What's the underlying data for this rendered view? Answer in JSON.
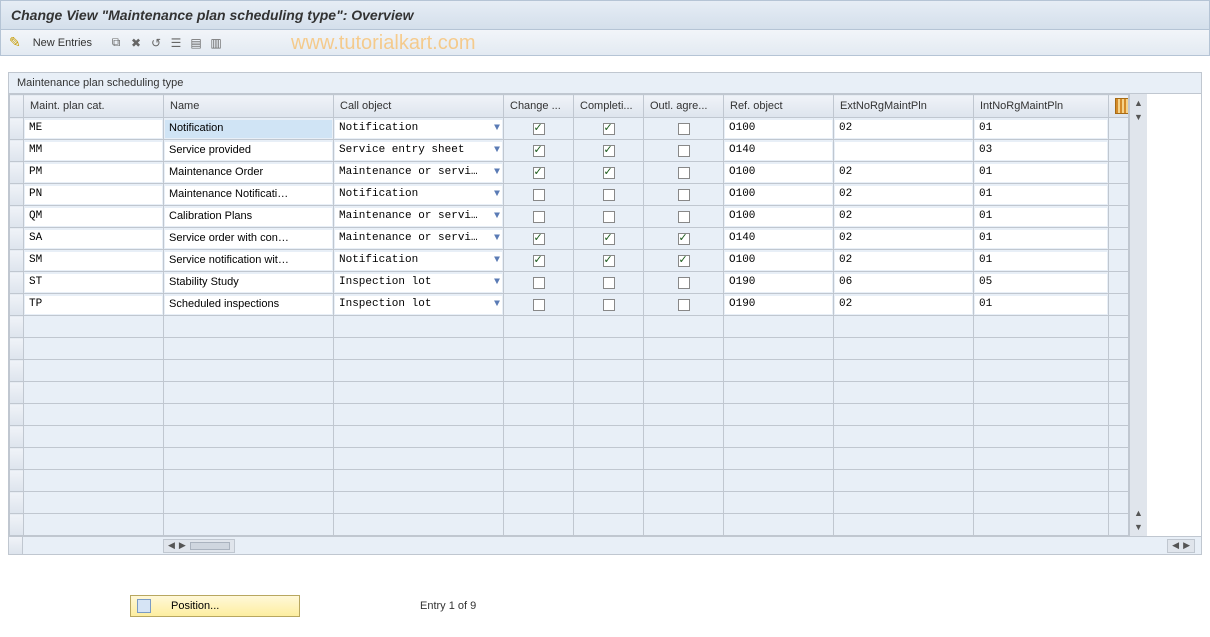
{
  "title": "Change View \"Maintenance plan scheduling type\": Overview",
  "toolbar": {
    "new_entries": "New Entries"
  },
  "watermark": "www.tutorialkart.com",
  "panel_title": "Maintenance plan scheduling type",
  "columns": {
    "c0": "Maint. plan cat.",
    "c1": "Name",
    "c2": "Call object",
    "c3": "Change ...",
    "c4": "Completi...",
    "c5": "Outl. agre...",
    "c6": "Ref. object",
    "c7": "ExtNoRgMaintPln",
    "c8": "IntNoRgMaintPln"
  },
  "rows": [
    {
      "cat": "ME",
      "name": "Notification",
      "call": "Notification",
      "chg": true,
      "cmp": true,
      "outl": false,
      "ref": "O100",
      "ext": "02",
      "int": "01",
      "sel": true
    },
    {
      "cat": "MM",
      "name": "Service provided",
      "call": "Service entry sheet",
      "chg": true,
      "cmp": true,
      "outl": false,
      "ref": "O140",
      "ext": "",
      "int": "03"
    },
    {
      "cat": "PM",
      "name": "Maintenance Order",
      "call": "Maintenance or servi…",
      "chg": true,
      "cmp": true,
      "outl": false,
      "ref": "O100",
      "ext": "02",
      "int": "01"
    },
    {
      "cat": "PN",
      "name": "Maintenance Notificati…",
      "call": "Notification",
      "chg": false,
      "cmp": false,
      "outl": false,
      "ref": "O100",
      "ext": "02",
      "int": "01"
    },
    {
      "cat": "QM",
      "name": "Calibration Plans",
      "call": "Maintenance or servi…",
      "chg": false,
      "cmp": false,
      "outl": false,
      "ref": "O100",
      "ext": "02",
      "int": "01"
    },
    {
      "cat": "SA",
      "name": "Service order with con…",
      "call": "Maintenance or servi…",
      "chg": true,
      "cmp": true,
      "outl": true,
      "ref": "O140",
      "ext": "02",
      "int": "01"
    },
    {
      "cat": "SM",
      "name": "Service notification wit…",
      "call": "Notification",
      "chg": true,
      "cmp": true,
      "outl": true,
      "ref": "O100",
      "ext": "02",
      "int": "01"
    },
    {
      "cat": "ST",
      "name": "Stability Study",
      "call": "Inspection lot",
      "chg": false,
      "cmp": false,
      "outl": false,
      "ref": "O190",
      "ext": "06",
      "int": "05"
    },
    {
      "cat": "TP",
      "name": "Scheduled inspections",
      "call": "Inspection lot",
      "chg": false,
      "cmp": false,
      "outl": false,
      "ref": "O190",
      "ext": "02",
      "int": "01"
    }
  ],
  "empty_rows": 10,
  "footer": {
    "position_label": "Position...",
    "entry_text": "Entry 1 of 9"
  }
}
